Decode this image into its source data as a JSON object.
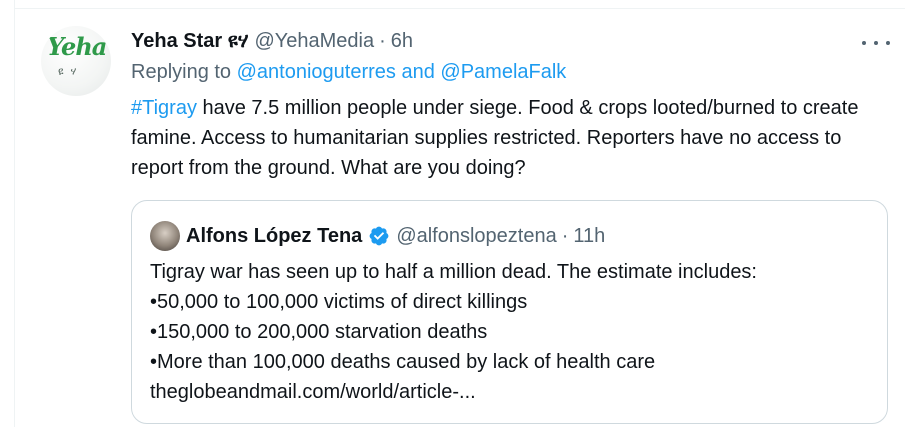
{
  "tweet": {
    "avatar_brand": "Yeha",
    "avatar_sub": "ዩ ሃ",
    "author_name": "Yeha Star ዩሃ",
    "author_handle": "@YehaMedia",
    "separator": "·",
    "time": "6h",
    "replying_prefix": "Replying to",
    "replying_to": "@antonioguterres and @PamelaFalk",
    "hashtag": "#Tigray",
    "text": " have 7.5 million people under siege. Food & crops looted/burned to create famine. Access to humanitarian supplies restricted. Reporters have no access to report from the ground. What are you doing?"
  },
  "quote": {
    "author_name": "Alfons López Tena",
    "author_handle": "@alfonslopeztena",
    "separator": "·",
    "time": "11h",
    "lines": [
      "Tigray war has seen up to half a million dead. The estimate includes:",
      "•50,000 to 100,000 victims of direct killings",
      "•150,000 to 200,000 starvation deaths",
      "•More than 100,000 deaths caused by lack of health care",
      "theglobeandmail.com/world/article-..."
    ]
  },
  "colors": {
    "link": "#1d9bf0",
    "verified": "#1d9bf0",
    "text": "#0f1419",
    "muted": "#536471",
    "border": "#cfd9de"
  },
  "icons": {
    "more": "more-horizontal-icon",
    "verified": "verified-badge-icon"
  }
}
